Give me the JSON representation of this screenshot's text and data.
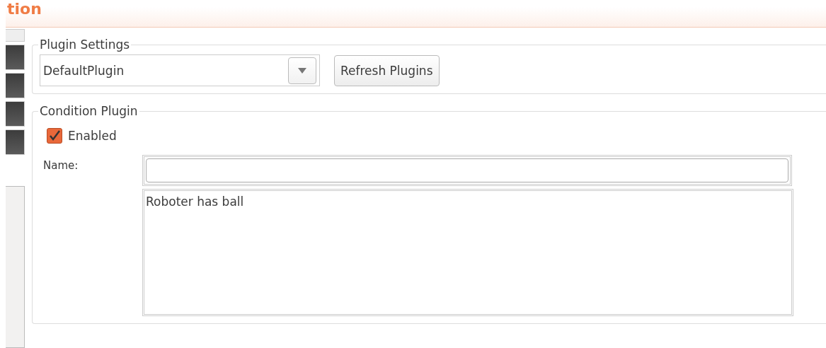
{
  "header": {
    "title": "tion"
  },
  "plugin_settings": {
    "title": "Plugin Settings",
    "plugin_select": {
      "value": "DefaultPlugin"
    },
    "refresh_button": "Refresh Plugins"
  },
  "condition_plugin": {
    "title": "Condition Plugin",
    "enabled": {
      "label": "Enabled",
      "checked": true
    },
    "name_label": "Name:",
    "description": "Roboter has ball"
  }
}
